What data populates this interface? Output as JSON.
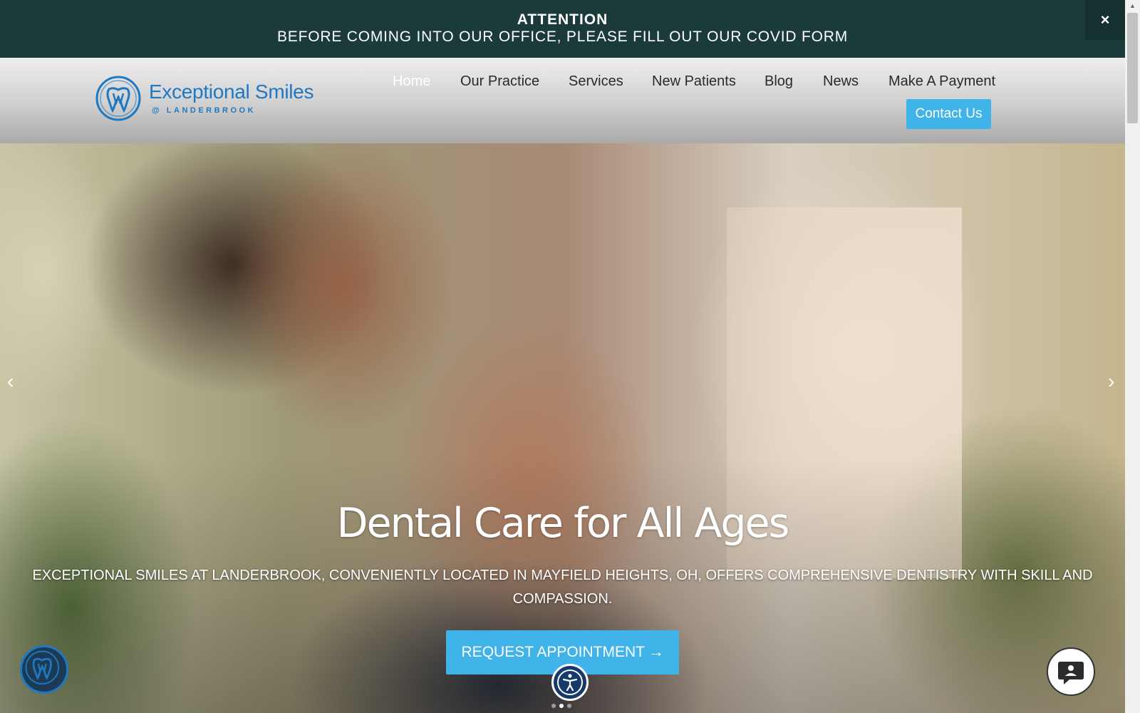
{
  "banner": {
    "title": "ATTENTION",
    "message": "BEFORE COMING INTO OUR OFFICE, PLEASE FILL OUT OUR COVID FORM",
    "close_label": "×"
  },
  "brand": {
    "name": "Exceptional Smiles",
    "subtitle": "@ LANDERBROOK",
    "color": "#1f78c1"
  },
  "nav": {
    "items": [
      {
        "label": "Home",
        "active": true
      },
      {
        "label": "Our Practice"
      },
      {
        "label": "Services"
      },
      {
        "label": "New Patients"
      },
      {
        "label": "Blog"
      },
      {
        "label": "News"
      },
      {
        "label": "Make A Payment"
      }
    ],
    "contact_label": "Contact Us"
  },
  "hero": {
    "title": "Dental Care for All Ages",
    "text": "EXCEPTIONAL SMILES AT LANDERBROOK, CONVENIENTLY LOCATED IN MAYFIELD HEIGHTS, OH, OFFERS COMPREHENSIVE DENTISTRY WITH SKILL AND COMPASSION.",
    "cta_label": "REQUEST APPOINTMENT →",
    "prev_label": "‹",
    "next_label": "›",
    "slide_count": 3,
    "active_slide": 2
  },
  "widgets": {
    "accessibility_icon": "accessibility-icon",
    "chat_icon": "chat-icon"
  },
  "colors": {
    "banner_bg": "#1b3a3a",
    "accent": "#40b3e8"
  }
}
